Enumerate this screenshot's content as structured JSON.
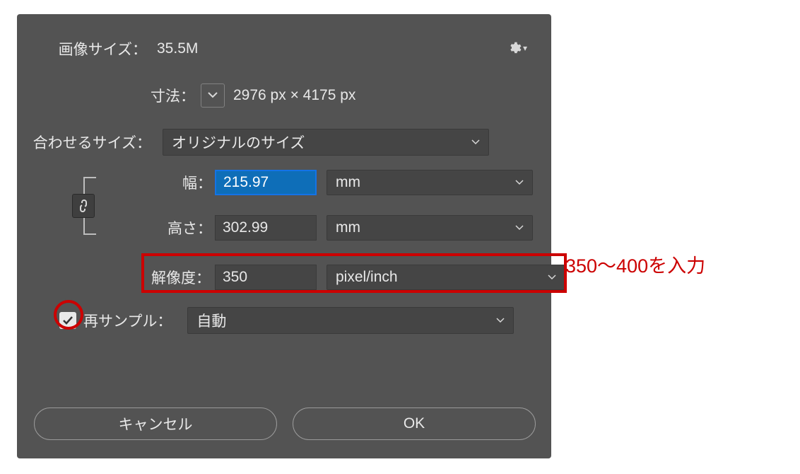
{
  "labels": {
    "imageSize": "画像サイズ",
    "dimensions": "寸法",
    "fitTo": "合わせるサイズ",
    "width": "幅",
    "height": "高さ",
    "resolution": "解像度",
    "resample": "再サンプル"
  },
  "values": {
    "imageSize": "35.5M",
    "dimensions": "2976 px × 4175 px",
    "fitTo": "オリジナルのサイズ",
    "width": "215.97",
    "height": "302.99",
    "widthUnit": "mm",
    "heightUnit": "mm",
    "resolution": "350",
    "resolutionUnit": "pixel/inch",
    "resample": "自動",
    "resampleChecked": true
  },
  "buttons": {
    "cancel": "キャンセル",
    "ok": "OK"
  },
  "annotation": "350〜400を入力",
  "colors": {
    "highlight": "#cc0000",
    "dialogBg": "#535353",
    "controlBg": "#454545"
  }
}
